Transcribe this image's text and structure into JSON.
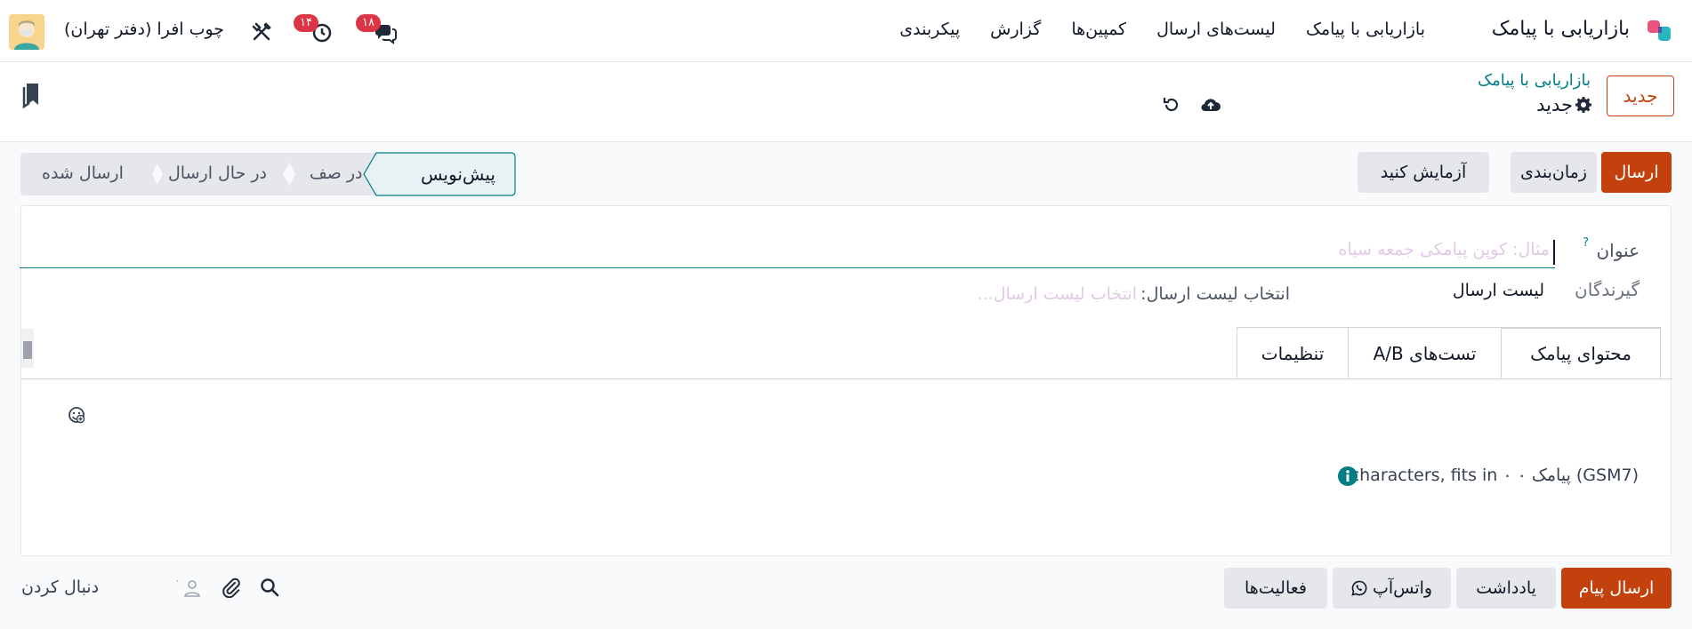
{
  "navbar": {
    "app_name": "بازاریابی با پیامک",
    "menu": [
      "بازاریابی با پیامک",
      "لیست‌های ارسال",
      "کمپین‌ها",
      "گزارش",
      "پیکربندی"
    ],
    "messages_count": "۱۸",
    "activities_count": "۱۴",
    "company": "چوب افرا (دفتر تهران)"
  },
  "control": {
    "new_button": "جدید",
    "breadcrumb_parent": "بازاریابی با پیامک",
    "breadcrumb_current": "جدید"
  },
  "actions": {
    "send": "ارسال",
    "schedule": "زمان‌بندی",
    "test": "آزمایش کنید"
  },
  "stages": {
    "draft": "پیش‌نویس",
    "queued": "در صف",
    "sending": "در حال ارسال",
    "sent": "ارسال شده"
  },
  "form": {
    "subject_label": "عنوان",
    "subject_help": "?",
    "subject_placeholder": "مثال: کوپن پیامکی جمعه سیاه",
    "recipients_label": "گیرندگان",
    "recipients_value": "لیست ارسال",
    "mailing_list_label": "انتخاب لیست ارسال:",
    "mailing_list_placeholder": "انتخاب لیست ارسال..."
  },
  "tabs": [
    "محتوای پیامک",
    "تست‌های A/B",
    "تنظیمات"
  ],
  "sms_info": "characters, fits in ۰ ۰ پیامک (GSM7)",
  "chatter": {
    "send_message": "ارسال پیام",
    "note": "یادداشت",
    "whatsapp": "واتس‌آپ",
    "activities": "فعالیت‌ها",
    "followers_count": "۰",
    "follow": "دنبال کردن"
  },
  "colors": {
    "primary": "#c2410c",
    "teal": "#017e84",
    "badge": "#dc3545"
  }
}
